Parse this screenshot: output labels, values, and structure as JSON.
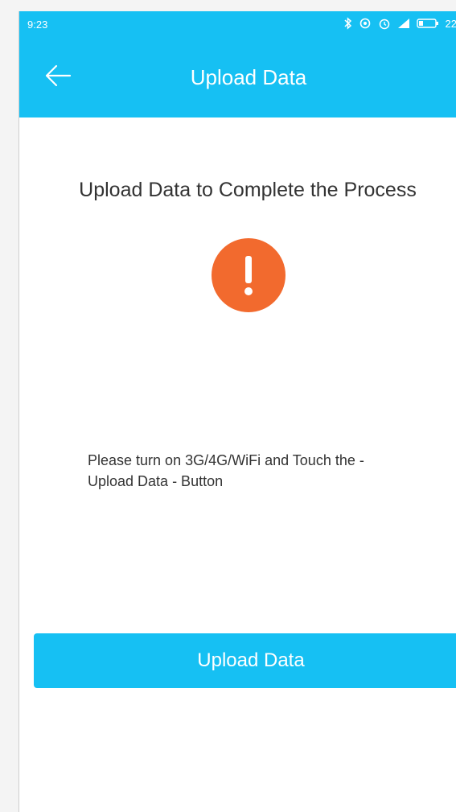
{
  "status_bar": {
    "time": "9:23",
    "battery": "22",
    "icons": [
      "bluetooth-icon",
      "sync-icon",
      "alarm-icon",
      "signal-icon",
      "battery-icon"
    ]
  },
  "app_bar": {
    "title": "Upload Data",
    "back_icon": "arrow-left-icon"
  },
  "content": {
    "heading": "Upload Data to Complete the Process",
    "alert_icon": "exclamation-icon",
    "message": "Please turn on 3G/4G/WiFi and Touch the - Upload Data - Button"
  },
  "actions": {
    "upload_label": "Upload Data"
  },
  "colors": {
    "primary": "#16c0f3",
    "alert": "#f26a2e",
    "text": "#333333",
    "background": "#ffffff"
  }
}
